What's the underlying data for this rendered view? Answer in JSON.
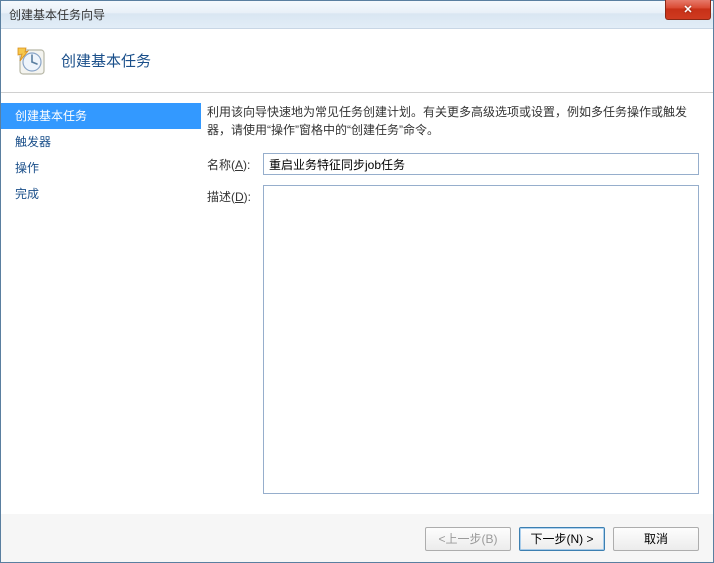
{
  "window": {
    "title": "创建基本任务向导"
  },
  "header": {
    "title": "创建基本任务"
  },
  "sidebar": {
    "items": [
      {
        "label": "创建基本任务",
        "selected": true
      },
      {
        "label": "触发器",
        "selected": false
      },
      {
        "label": "操作",
        "selected": false
      },
      {
        "label": "完成",
        "selected": false
      }
    ]
  },
  "content": {
    "intro": "利用该向导快速地为常见任务创建计划。有关更多高级选项或设置，例如多任务操作或触发器，请使用“操作”窗格中的“创建任务”命令。",
    "name_label_prefix": "名称(",
    "name_label_key": "A",
    "name_label_suffix": "):",
    "name_value": "重启业务特征同步job任务",
    "desc_label_prefix": "描述(",
    "desc_label_key": "D",
    "desc_label_suffix": "):",
    "desc_value": ""
  },
  "footer": {
    "back": "<上一步(B)",
    "next": "下一步(N) >",
    "cancel": "取消"
  }
}
